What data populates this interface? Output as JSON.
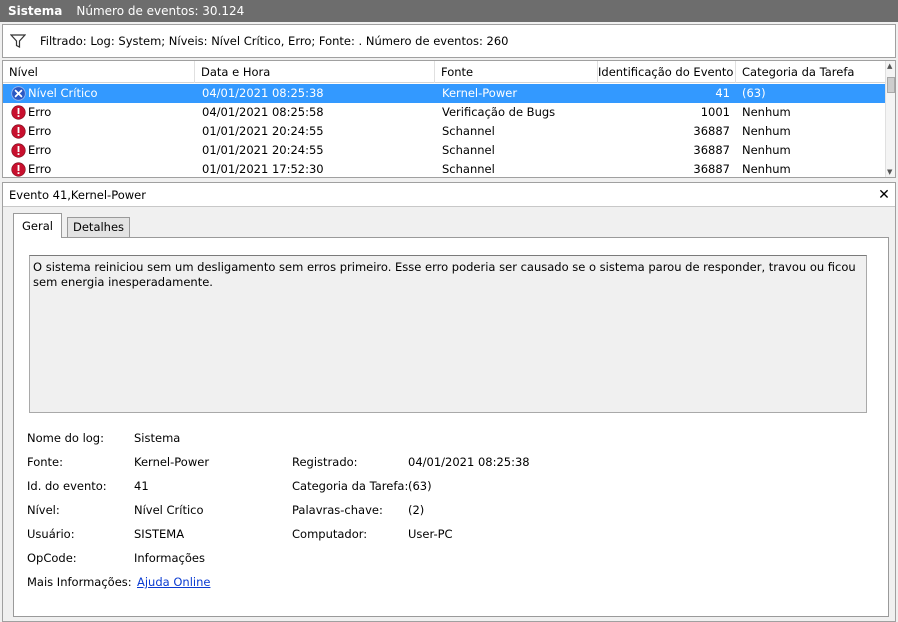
{
  "titlebar": {
    "name": "Sistema",
    "count_text": "Número de eventos: 30.124"
  },
  "filter": {
    "text": "Filtrado: Log: System; Níveis: Nível Crítico, Erro; Fonte: . Número de eventos: 260"
  },
  "grid": {
    "columns": [
      "Nível",
      "Data e Hora",
      "Fonte",
      "Identificação do Evento",
      "Categoria da Tarefa"
    ],
    "rows": [
      {
        "level": "Nível Crítico",
        "icon": "critical-icon",
        "datetime": "04/01/2021 08:25:38",
        "source": "Kernel-Power",
        "event_id": "41",
        "category": "(63)",
        "selected": true
      },
      {
        "level": "Erro",
        "icon": "error-icon",
        "datetime": "04/01/2021 08:25:58",
        "source": "Verificação de Bugs",
        "event_id": "1001",
        "category": "Nenhum",
        "selected": false
      },
      {
        "level": "Erro",
        "icon": "error-icon",
        "datetime": "01/01/2021 20:24:55",
        "source": "Schannel",
        "event_id": "36887",
        "category": "Nenhum",
        "selected": false
      },
      {
        "level": "Erro",
        "icon": "error-icon",
        "datetime": "01/01/2021 20:24:55",
        "source": "Schannel",
        "event_id": "36887",
        "category": "Nenhum",
        "selected": false
      },
      {
        "level": "Erro",
        "icon": "error-icon",
        "datetime": "01/01/2021 17:52:30",
        "source": "Schannel",
        "event_id": "36887",
        "category": "Nenhum",
        "selected": false
      }
    ]
  },
  "detail": {
    "title": "Evento 41,Kernel-Power",
    "tabs": [
      "Geral",
      "Detalhes"
    ],
    "description": "O sistema reiniciou sem um desligamento sem erros primeiro. Esse erro poderia ser causado se o sistema parou de responder, travou ou ficou sem energia inesperadamente.",
    "fields": {
      "log_label": "Nome do log:",
      "log_value": "Sistema",
      "source_label": "Fonte:",
      "source_value": "Kernel-Power",
      "registered_label": "Registrado:",
      "registered_value": "04/01/2021 08:25:38",
      "event_id_label": "Id. do evento:",
      "event_id_value": "41",
      "task_label": "Categoria da Tarefa:",
      "task_value": "(63)",
      "level_label": "Nível:",
      "level_value": "Nível Crítico",
      "keywords_label": "Palavras-chave:",
      "keywords_value": "(2)",
      "user_label": "Usuário:",
      "user_value": "SISTEMA",
      "computer_label": "Computador:",
      "computer_value": "User-PC",
      "opcode_label": "OpCode:",
      "opcode_value": "Informações",
      "more_info_label": "Mais Informações:",
      "more_info_link": "Ajuda Online"
    }
  },
  "colors": {
    "selected_row": "#3399ff",
    "titlebar": "#6d6d6d",
    "link": "#0a3bd1",
    "error": "#c8102e",
    "critical": "#2b59c3"
  }
}
